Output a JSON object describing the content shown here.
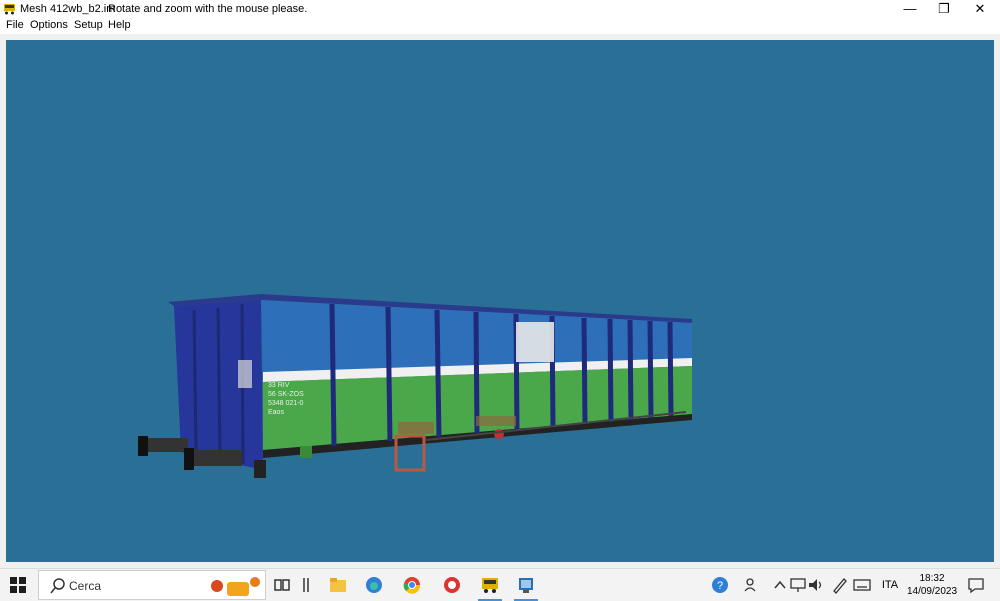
{
  "window": {
    "title": "Mesh 412wb_b2.im",
    "message": "Rotate and zoom with the mouse please.",
    "controls": {
      "minimize": "—",
      "restore": "❐",
      "close": "✕"
    }
  },
  "menu": {
    "items": [
      "File",
      "Options",
      "Setup",
      "Help"
    ]
  },
  "viewport": {
    "background": "#2a6f95",
    "wagon_markings": {
      "number_line1": "33 RIV",
      "number_line2": "56 SK-ZOS",
      "number_line3": "5348 021-0",
      "class": "Eaos"
    }
  },
  "taskbar": {
    "search_placeholder": "Cerca",
    "icons": [
      "start-icon",
      "task-view-icon",
      "file-explorer-icon",
      "edge-icon",
      "chrome-icon",
      "ccleaner-icon",
      "train-app-icon",
      "mesh-viewer-icon"
    ],
    "tray": {
      "language": "ITA",
      "time": "18:32",
      "date": "14/09/2023"
    }
  }
}
